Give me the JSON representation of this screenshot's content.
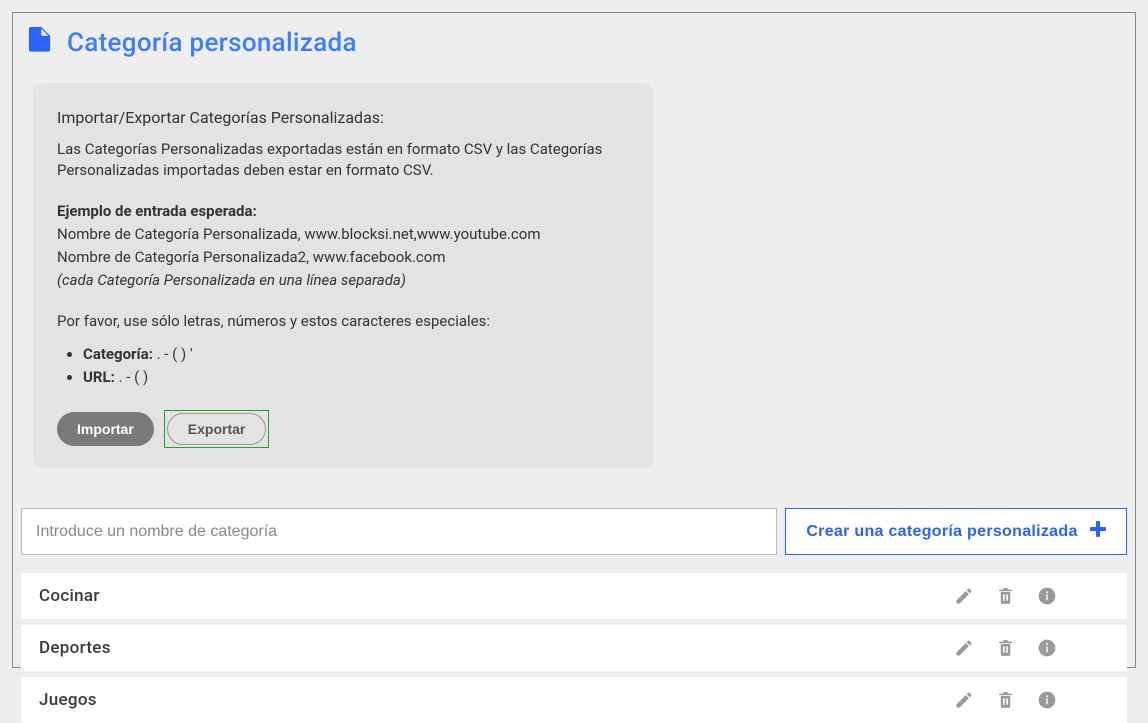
{
  "header": {
    "title": "Categoría personalizada"
  },
  "infoBox": {
    "title": "Importar/Exportar Categorías Personalizadas:",
    "description": "Las Categorías Personalizadas exportadas están en formato CSV y las Categorías Personalizadas importadas deben estar en formato CSV.",
    "exampleTitle": "Ejemplo de entrada esperada:",
    "exampleLine1": "Nombre de Categoría Personalizada, www.blocksi.net,www.youtube.com",
    "exampleLine2": "Nombre de Categoría Personalizada2, www.facebook.com",
    "exampleEach": "(cada Categoría Personalizada en una línea separada)",
    "charsNote": "Por favor, use sólo letras, números y estos caracteres especiales:",
    "categoryLabel": "Categoría:",
    "categoryChars": " . - ( ) '",
    "urlLabel": "URL:",
    "urlChars": " . - ( )",
    "importButton": "Importar",
    "exportButton": "Exportar"
  },
  "input": {
    "placeholder": "Introduce un nombre de categoría"
  },
  "createButton": {
    "label": "Crear una categoría personalizada"
  },
  "categories": [
    {
      "name": "Cocinar"
    },
    {
      "name": "Deportes"
    },
    {
      "name": "Juegos"
    }
  ]
}
